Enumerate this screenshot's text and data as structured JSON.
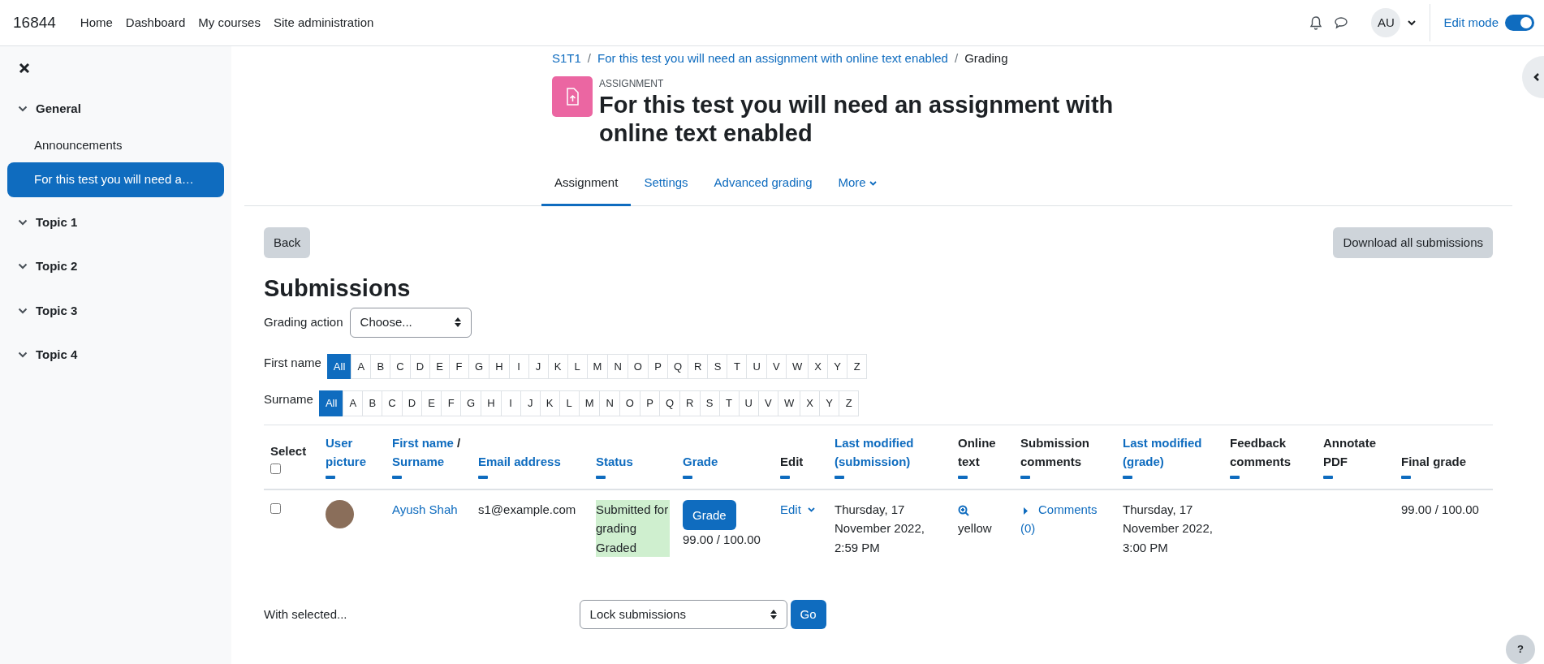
{
  "navbar": {
    "brand": "16844",
    "links": [
      "Home",
      "Dashboard",
      "My courses",
      "Site administration"
    ],
    "avatar_initials": "AU",
    "edit_mode": {
      "label": "Edit mode",
      "on": true
    }
  },
  "sidebar": {
    "items": [
      {
        "label": "General",
        "kind": "section",
        "expanded": true,
        "selected": false
      },
      {
        "label": "Announcements",
        "kind": "activity",
        "selected": false
      },
      {
        "label": "For this test you will need a…",
        "kind": "activity",
        "selected": true
      },
      {
        "label": "Topic 1",
        "kind": "section",
        "expanded": true,
        "selected": false
      },
      {
        "label": "Topic 2",
        "kind": "section",
        "expanded": true,
        "selected": false
      },
      {
        "label": "Topic 3",
        "kind": "section",
        "expanded": true,
        "selected": false
      },
      {
        "label": "Topic 4",
        "kind": "section",
        "expanded": true,
        "selected": false
      }
    ]
  },
  "breadcrumb_separator": "/",
  "breadcrumb": [
    {
      "text": "S1T1",
      "link": true
    },
    {
      "text": "For this test you will need an assignment with online text enabled",
      "link": true
    },
    {
      "text": "Grading",
      "link": false
    }
  ],
  "header": {
    "overline": "ASSIGNMENT",
    "title": "For this test you will need an assignment with online text enabled"
  },
  "tabs": [
    {
      "label": "Assignment",
      "selected": true,
      "menu": false
    },
    {
      "label": "Settings",
      "selected": false,
      "menu": false
    },
    {
      "label": "Advanced grading",
      "selected": false,
      "menu": false
    },
    {
      "label": "More",
      "selected": false,
      "menu": true
    }
  ],
  "buttons": {
    "back": "Back",
    "download": "Download all submissions"
  },
  "heading": "Submissions",
  "grading_action": {
    "label": "Grading action",
    "value": "Choose..."
  },
  "filters": [
    {
      "label": "First name",
      "letters": [
        {
          "text": "All",
          "selected": true
        },
        {
          "text": "A",
          "selected": false
        },
        {
          "text": "B",
          "selected": false
        },
        {
          "text": "C",
          "selected": false
        },
        {
          "text": "D",
          "selected": false
        },
        {
          "text": "E",
          "selected": false
        },
        {
          "text": "F",
          "selected": false
        },
        {
          "text": "G",
          "selected": false
        },
        {
          "text": "H",
          "selected": false
        },
        {
          "text": "I",
          "selected": false
        },
        {
          "text": "J",
          "selected": false
        },
        {
          "text": "K",
          "selected": false
        },
        {
          "text": "L",
          "selected": false
        },
        {
          "text": "M",
          "selected": false
        },
        {
          "text": "N",
          "selected": false
        },
        {
          "text": "O",
          "selected": false
        },
        {
          "text": "P",
          "selected": false
        },
        {
          "text": "Q",
          "selected": false
        },
        {
          "text": "R",
          "selected": false
        },
        {
          "text": "S",
          "selected": false
        },
        {
          "text": "T",
          "selected": false
        },
        {
          "text": "U",
          "selected": false
        },
        {
          "text": "V",
          "selected": false
        },
        {
          "text": "W",
          "selected": false
        },
        {
          "text": "X",
          "selected": false
        },
        {
          "text": "Y",
          "selected": false
        },
        {
          "text": "Z",
          "selected": false
        }
      ]
    },
    {
      "label": "Surname",
      "letters": [
        {
          "text": "All",
          "selected": true
        },
        {
          "text": "A",
          "selected": false
        },
        {
          "text": "B",
          "selected": false
        },
        {
          "text": "C",
          "selected": false
        },
        {
          "text": "D",
          "selected": false
        },
        {
          "text": "E",
          "selected": false
        },
        {
          "text": "F",
          "selected": false
        },
        {
          "text": "G",
          "selected": false
        },
        {
          "text": "H",
          "selected": false
        },
        {
          "text": "I",
          "selected": false
        },
        {
          "text": "J",
          "selected": false
        },
        {
          "text": "K",
          "selected": false
        },
        {
          "text": "L",
          "selected": false
        },
        {
          "text": "M",
          "selected": false
        },
        {
          "text": "N",
          "selected": false
        },
        {
          "text": "O",
          "selected": false
        },
        {
          "text": "P",
          "selected": false
        },
        {
          "text": "Q",
          "selected": false
        },
        {
          "text": "R",
          "selected": false
        },
        {
          "text": "S",
          "selected": false
        },
        {
          "text": "T",
          "selected": false
        },
        {
          "text": "U",
          "selected": false
        },
        {
          "text": "V",
          "selected": false
        },
        {
          "text": "W",
          "selected": false
        },
        {
          "text": "X",
          "selected": false
        },
        {
          "text": "Y",
          "selected": false
        },
        {
          "text": "Z",
          "selected": false
        }
      ]
    }
  ],
  "table": {
    "select_all_checked": false,
    "columns": [
      {
        "parts": [
          {
            "text": "Select",
            "link": false
          }
        ],
        "collapsible": false
      },
      {
        "parts": [
          {
            "text": "User picture",
            "link": true
          }
        ],
        "collapsible": true
      },
      {
        "parts": [
          {
            "text": "First name",
            "link": true
          },
          {
            "text": "/",
            "link": false
          },
          {
            "text": "Surname",
            "link": true
          }
        ],
        "collapsible": true
      },
      {
        "parts": [
          {
            "text": "Email address",
            "link": true
          }
        ],
        "collapsible": true
      },
      {
        "parts": [
          {
            "text": "Status",
            "link": true
          }
        ],
        "collapsible": true
      },
      {
        "parts": [
          {
            "text": "Grade",
            "link": true
          }
        ],
        "collapsible": true
      },
      {
        "parts": [
          {
            "text": "Edit",
            "link": false
          }
        ],
        "collapsible": true
      },
      {
        "parts": [
          {
            "text": "Last modified (submission)",
            "link": true
          }
        ],
        "collapsible": true
      },
      {
        "parts": [
          {
            "text": "Online text",
            "link": false
          }
        ],
        "collapsible": true
      },
      {
        "parts": [
          {
            "text": "Submission comments",
            "link": false
          }
        ],
        "collapsible": true
      },
      {
        "parts": [
          {
            "text": "Last modified (grade)",
            "link": true
          }
        ],
        "collapsible": true
      },
      {
        "parts": [
          {
            "text": "Feedback comments",
            "link": false
          }
        ],
        "collapsible": true
      },
      {
        "parts": [
          {
            "text": "Annotate PDF",
            "link": false
          }
        ],
        "collapsible": true
      },
      {
        "parts": [
          {
            "text": "Final grade",
            "link": false
          }
        ],
        "collapsible": true
      }
    ],
    "rows": [
      {
        "checked": false,
        "name": "Ayush Shah",
        "email": "s1@example.com",
        "status": [
          "Submitted for grading",
          "Graded"
        ],
        "grade_button": "Grade",
        "grade": "99.00 / 100.00",
        "edit": "Edit",
        "last_modified_submission": "Thursday, 17 November 2022, 2:59 PM",
        "online_text": "yellow",
        "comments": "Comments (0)",
        "last_modified_grade": "Thursday, 17 November 2022, 3:00 PM",
        "final_grade": "99.00 / 100.00"
      }
    ]
  },
  "bulk": {
    "label": "With selected...",
    "value": "Lock submissions",
    "go": "Go"
  },
  "help": "?"
}
